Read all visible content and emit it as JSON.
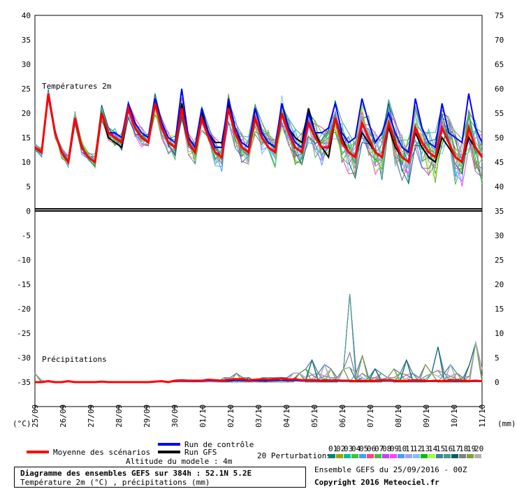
{
  "chart_data": {
    "type": "line",
    "x": [
      "25/09",
      "26/09",
      "27/09",
      "28/09",
      "29/09",
      "30/09",
      "01/10",
      "02/10",
      "03/10",
      "04/10",
      "05/10",
      "06/10",
      "07/10",
      "08/10",
      "09/10",
      "10/10",
      "11/10"
    ],
    "left_ticks": [
      40,
      35,
      30,
      25,
      20,
      15,
      10,
      5,
      0,
      -5,
      -10,
      -15,
      -20,
      -25,
      -30,
      -35
    ],
    "right_ticks": [
      75,
      70,
      65,
      60,
      55,
      50,
      45,
      40,
      35,
      30,
      25,
      20,
      15,
      10,
      5,
      0
    ],
    "left_unit": "(°C)",
    "right_unit": "(mm)",
    "temp_title": "Températures 2m",
    "precip_title": "Précipitations",
    "temperature_mean": [
      13,
      12,
      24,
      16,
      12,
      10,
      19,
      13,
      11,
      10,
      20,
      16,
      15,
      14,
      21,
      17,
      15,
      14,
      22,
      17,
      14,
      13,
      21,
      14,
      12,
      19,
      15,
      12,
      11,
      21,
      16,
      13,
      12,
      19,
      15,
      13,
      12,
      20,
      16,
      13,
      12,
      18,
      15,
      13,
      13,
      19,
      14,
      12,
      11,
      18,
      15,
      12,
      11,
      18,
      14,
      11,
      10,
      17,
      14,
      12,
      11,
      17,
      14,
      11,
      10,
      17,
      13,
      11
    ],
    "temperature_control": [
      13,
      12,
      24,
      16,
      12,
      10,
      19,
      13,
      11,
      10,
      20,
      16,
      16,
      15,
      22,
      18,
      16,
      15,
      23,
      18,
      15,
      14,
      25,
      15,
      13,
      21,
      16,
      13,
      13,
      23,
      17,
      14,
      13,
      21,
      16,
      14,
      13,
      22,
      17,
      14,
      13,
      20,
      16,
      16,
      17,
      22,
      16,
      14,
      15,
      23,
      18,
      14,
      16,
      20,
      16,
      13,
      12,
      23,
      17,
      14,
      13,
      22,
      16,
      15,
      14,
      24,
      17,
      14
    ],
    "temperature_gfs": [
      13,
      12,
      24,
      16,
      12,
      10,
      19,
      13,
      11,
      10,
      20,
      15,
      14,
      13,
      21,
      17,
      15,
      14,
      22,
      17,
      14,
      13,
      22,
      15,
      13,
      20,
      16,
      14,
      14,
      22,
      16,
      14,
      13,
      21,
      16,
      14,
      13,
      22,
      17,
      15,
      14,
      21,
      16,
      13,
      11,
      19,
      15,
      12,
      11,
      16,
      14,
      12,
      11,
      17,
      13,
      11,
      10,
      16,
      13,
      11,
      10,
      15,
      13,
      11,
      10,
      15,
      13,
      11
    ],
    "precip_mean": [
      0,
      0,
      0.2,
      0,
      0,
      0.2,
      0,
      0,
      0,
      0,
      0.1,
      0,
      0,
      0,
      0,
      0,
      0,
      0,
      0.1,
      0.2,
      0,
      0.3,
      0.4,
      0.3,
      0.3,
      0.3,
      0.5,
      0.4,
      0.3,
      0.5,
      0.6,
      0.6,
      0.4,
      0.5,
      0.6,
      0.5,
      0.6,
      0.8,
      0.5,
      0.6,
      0.4,
      0.4,
      0.4,
      0.3,
      0.3,
      0.4,
      0.3,
      0.3,
      0.2,
      0.3,
      0.2,
      0.3,
      0.4,
      0.4,
      0.3,
      0.2,
      0.3,
      0.4,
      0.3,
      0.2,
      0.3,
      0.2,
      0.3,
      0.4,
      0.3,
      0.2,
      0.3,
      0.2
    ],
    "precip_peaks": [
      2,
      0.5,
      0,
      0,
      0,
      0,
      0,
      0,
      0,
      0,
      0,
      0,
      0,
      0,
      0,
      0,
      0,
      0,
      0,
      0,
      0,
      0,
      0,
      0,
      0,
      0,
      0,
      0,
      0,
      0,
      1,
      1,
      2,
      1,
      1,
      0,
      1,
      1,
      1,
      1,
      1,
      2,
      2,
      3,
      5,
      2,
      4,
      3,
      1,
      3,
      20,
      2,
      6,
      1,
      3,
      2,
      1,
      3,
      2,
      5,
      2,
      1,
      4,
      2,
      8,
      2,
      4,
      2,
      1,
      4,
      9,
      3
    ],
    "legend": {
      "mean": "Moyenne des scénarios",
      "control": "Run de contrôle",
      "gfs": "Run GFS",
      "perturbations": "20 Perturbations",
      "altitude": "Altitude du modele : 4m",
      "ensemble": "Ensemble GEFS du 25/09/2016 - 00Z",
      "copyright": "Copyright 2016 Meteociel.fr",
      "title": "Diagramme des ensembles GEFS sur 384h : 52.1N 5.2E",
      "subtitle": "Température 2m (°C) , précipitations (mm)"
    },
    "pert_labels": [
      "01",
      "02",
      "03",
      "04",
      "05",
      "06",
      "07",
      "08",
      "09",
      "10",
      "11",
      "12",
      "13",
      "14",
      "15",
      "16",
      "17",
      "18",
      "19",
      "20"
    ],
    "pert_colors": [
      "#008080",
      "#a0a000",
      "#00c0a0",
      "#40c040",
      "#40a0ff",
      "#ff4080",
      "#40c040",
      "#c040ff",
      "#ff40ff",
      "#40a0ff",
      "#a0a0ff",
      "#80c0ff",
      "#00c000",
      "#a0ff40",
      "#4080a0",
      "#40a080",
      "#006060",
      "#808080",
      "#80a040",
      "#b0b0b0"
    ],
    "colors": {
      "mean": "#ff0000",
      "control": "#0000ff",
      "gfs": "#000000"
    }
  }
}
